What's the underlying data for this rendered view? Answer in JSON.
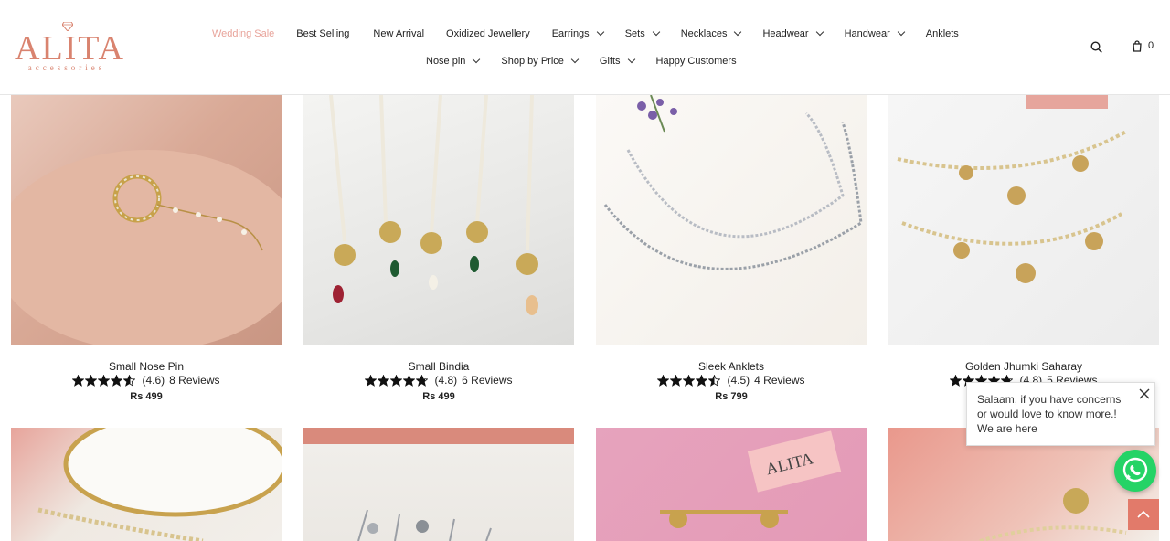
{
  "brand": {
    "name": "ALITA",
    "tagline": "accessories",
    "color": "#d9836f"
  },
  "nav": {
    "row1": [
      {
        "label": "Wedding Sale",
        "dropdown": false,
        "active": true
      },
      {
        "label": "Best Selling",
        "dropdown": false
      },
      {
        "label": "New Arrival",
        "dropdown": false
      },
      {
        "label": "Oxidized Jewellery",
        "dropdown": false
      },
      {
        "label": "Earrings",
        "dropdown": true
      },
      {
        "label": "Sets",
        "dropdown": true
      },
      {
        "label": "Necklaces",
        "dropdown": true
      },
      {
        "label": "Headwear",
        "dropdown": true
      },
      {
        "label": "Handwear",
        "dropdown": true
      },
      {
        "label": "Anklets",
        "dropdown": false
      }
    ],
    "row2": [
      {
        "label": "Nose pin",
        "dropdown": true
      },
      {
        "label": "Shop by Price",
        "dropdown": true
      },
      {
        "label": "Gifts",
        "dropdown": true
      },
      {
        "label": "Happy Customers",
        "dropdown": false
      }
    ],
    "active_color": "#e8a39a"
  },
  "header_icons": {
    "search": "search-icon",
    "cart": "cart-icon",
    "cart_count": "0"
  },
  "products": [
    {
      "title": "Small Nose Pin",
      "rating": 4.6,
      "rating_text": "(4.6)",
      "reviews": "8 Reviews",
      "price": "Rs 499",
      "image": "nose-pin-on-palm"
    },
    {
      "title": "Small Bindia",
      "rating": 4.8,
      "rating_text": "(4.8)",
      "reviews": "6 Reviews",
      "price": "Rs 499",
      "image": "bindia-pendants-on-cloth"
    },
    {
      "title": "Sleek Anklets",
      "rating": 4.5,
      "rating_text": "(4.5)",
      "reviews": "4 Reviews",
      "price": "Rs 799",
      "image": "anklets-with-flowers"
    },
    {
      "title": "Golden Jhumki Saharay",
      "rating": 4.8,
      "rating_text": "(4.8)",
      "reviews": "5 Reviews",
      "price": "",
      "image": "jhumki-saharay-chains"
    }
  ],
  "products_row2": [
    {
      "image": "kada-bangle"
    },
    {
      "image": "stud-earrings"
    },
    {
      "image": "earrings-with-brand-card"
    },
    {
      "image": "saharay-on-pink"
    }
  ],
  "chat": {
    "message": "Salaam, if you have concerns or would love to know more.! We are here",
    "close_icon": "close-icon",
    "whatsapp_icon": "whatsapp-icon",
    "whatsapp_color": "#25d366"
  },
  "back_to_top": {
    "icon": "chevron-up-icon",
    "color": "#e27a6a"
  }
}
